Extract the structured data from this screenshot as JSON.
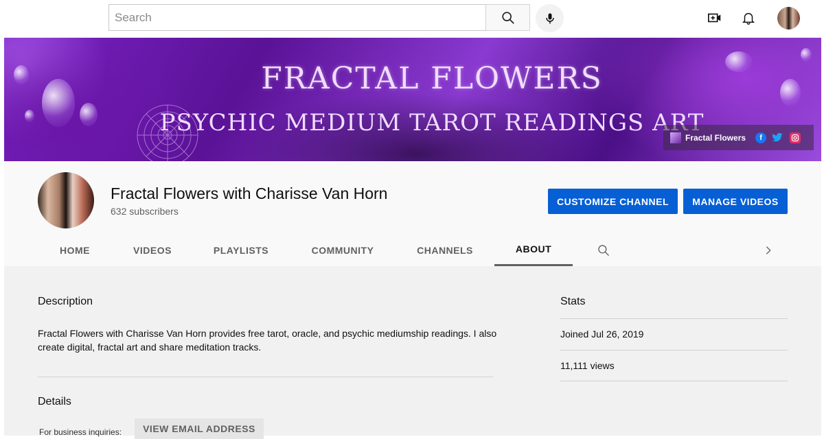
{
  "search": {
    "placeholder": "Search"
  },
  "banner": {
    "title": "FRACTAL FLOWERS",
    "subtitle": "PSYCHIC MEDIUM TAROT READINGS ART",
    "link_label": "Fractal Flowers",
    "socials": [
      "facebook-icon",
      "twitter-icon",
      "instagram-icon"
    ]
  },
  "channel": {
    "name": "Fractal Flowers with Charisse Van Horn",
    "subscribers": "632 subscribers",
    "customize_label": "CUSTOMIZE CHANNEL",
    "manage_label": "MANAGE VIDEOS"
  },
  "tabs": [
    {
      "label": "HOME"
    },
    {
      "label": "VIDEOS"
    },
    {
      "label": "PLAYLISTS"
    },
    {
      "label": "COMMUNITY"
    },
    {
      "label": "CHANNELS"
    },
    {
      "label": "ABOUT",
      "active": true
    }
  ],
  "about": {
    "description_heading": "Description",
    "description_text": "Fractal Flowers with Charisse Van Horn provides free tarot, oracle, and psychic mediumship readings. I also create digital, fractal art and share meditation tracks.",
    "details_heading": "Details",
    "business_label": "For business inquiries:",
    "email_button": "VIEW EMAIL ADDRESS"
  },
  "stats": {
    "heading": "Stats",
    "joined": "Joined Jul 26, 2019",
    "views": "11,111 views"
  },
  "colors": {
    "accent_blue": "#065fd4",
    "facebook": "#1877f2",
    "twitter": "#1da1f2",
    "instagram": "#e1306c"
  }
}
